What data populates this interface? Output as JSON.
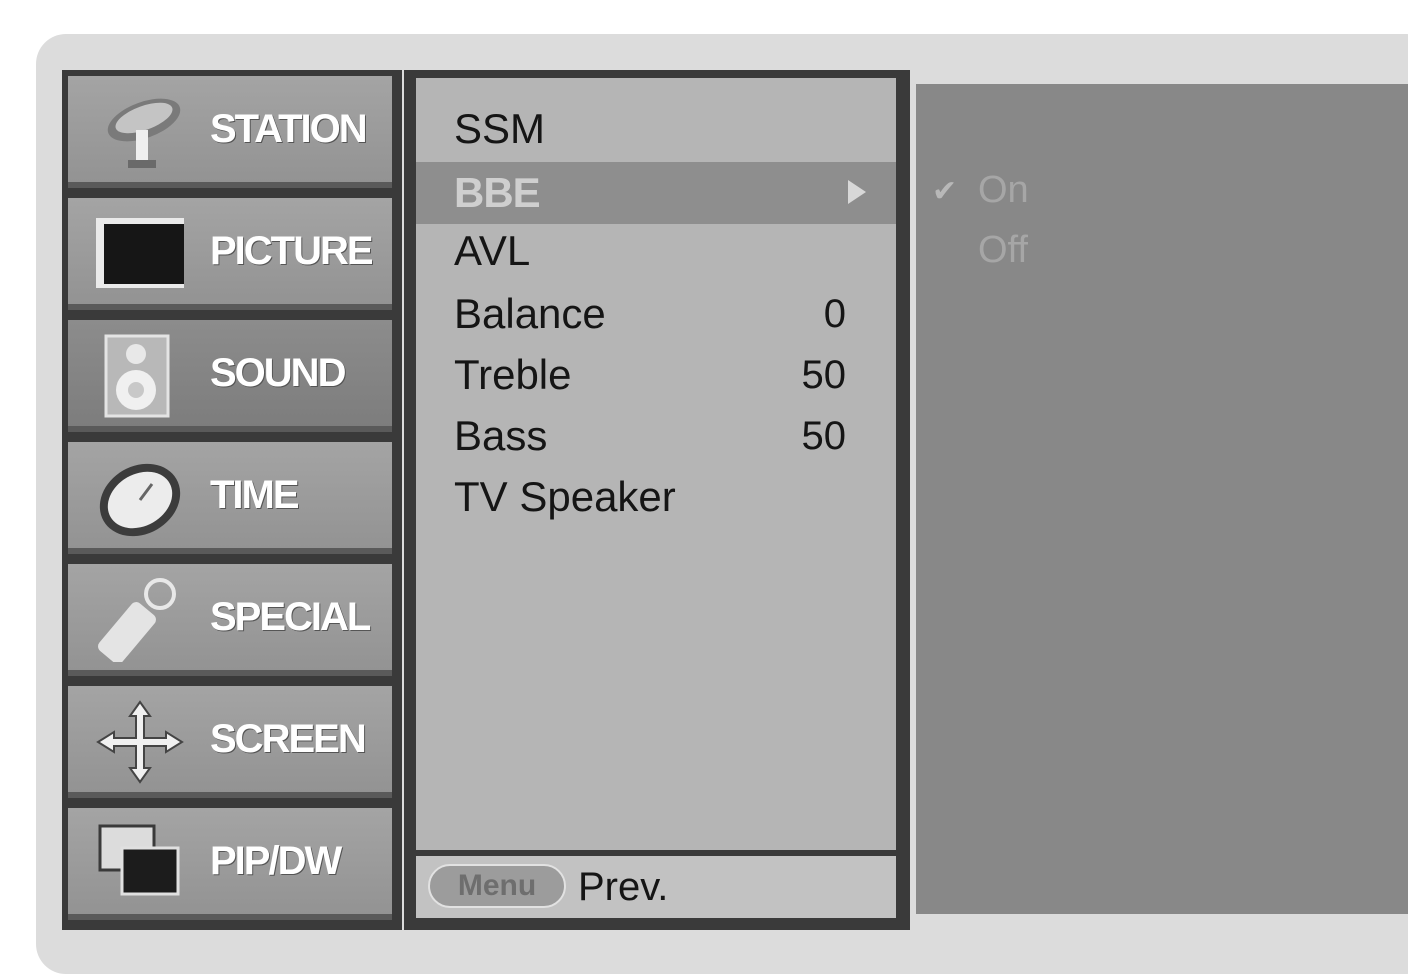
{
  "categories": [
    {
      "label": "STATION",
      "icon": "satellite-dish-icon",
      "active": false
    },
    {
      "label": "PICTURE",
      "icon": "tv-screen-icon",
      "active": false
    },
    {
      "label": "SOUND",
      "icon": "speaker-icon",
      "active": true
    },
    {
      "label": "TIME",
      "icon": "clock-icon",
      "active": false
    },
    {
      "label": "SPECIAL",
      "icon": "remote-control-icon",
      "active": false
    },
    {
      "label": "SCREEN",
      "icon": "move-arrows-icon",
      "active": false
    },
    {
      "label": "PIP/DW",
      "icon": "pip-windows-icon",
      "active": false
    }
  ],
  "submenu": {
    "items": [
      {
        "label": "SSM",
        "value": ""
      },
      {
        "label": "BBE",
        "value": "",
        "selected": true
      },
      {
        "label": "AVL",
        "value": ""
      },
      {
        "label": "Balance",
        "value": "0"
      },
      {
        "label": "Treble",
        "value": "50"
      },
      {
        "label": "Bass",
        "value": "50"
      },
      {
        "label": "TV Speaker",
        "value": ""
      }
    ],
    "footer": {
      "button_label": "Menu",
      "label": "Prev."
    }
  },
  "options": {
    "check_mark": "✔",
    "items": [
      {
        "label": "On",
        "checked": true
      },
      {
        "label": "Off",
        "checked": false
      }
    ]
  },
  "colors": {
    "panel_dark": "#3a3a3a",
    "category_bg": "#9c9c9c",
    "submenu_bg": "#b5b5b5",
    "selected_row": "#8e8e8e",
    "option_bg": "#888888"
  }
}
